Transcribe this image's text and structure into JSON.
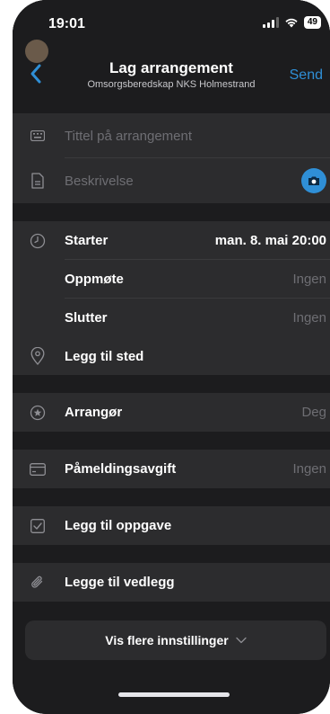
{
  "status_bar": {
    "time": "19:01",
    "battery": "49"
  },
  "nav": {
    "title": "Lag arrangement",
    "subtitle": "Omsorgsberedskap NKS Holmestrand",
    "send_label": "Send"
  },
  "details": {
    "title_placeholder": "Tittel på arrangement",
    "description_placeholder": "Beskrivelse"
  },
  "time": {
    "starts_label": "Starter",
    "starts_value": "man. 8. mai  20:00",
    "meet_label": "Oppmøte",
    "meet_value": "Ingen",
    "ends_label": "Slutter",
    "ends_value": "Ingen",
    "location_label": "Legg til sted"
  },
  "organizer": {
    "label": "Arrangør",
    "value": "Deg"
  },
  "fee": {
    "label": "Påmeldingsavgift",
    "value": "Ingen"
  },
  "task": {
    "label": "Legg til oppgave"
  },
  "attachment": {
    "label": "Legge til vedlegg"
  },
  "more_settings": {
    "label": "Vis flere innstillinger"
  },
  "colors": {
    "accent": "#2f8fd6",
    "background": "#1c1c1e",
    "section": "#2c2c2e"
  }
}
